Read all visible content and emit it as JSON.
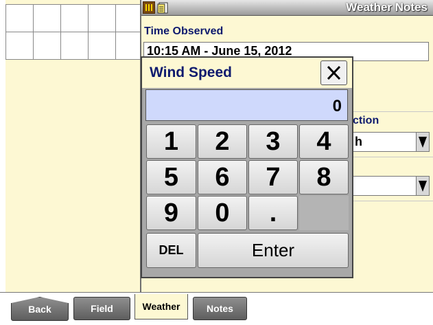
{
  "header": {
    "title": "Weather Notes",
    "icons": [
      "field-map-icon",
      "notepad-icon"
    ]
  },
  "form": {
    "time_label": "Time Observed",
    "time_value": "10:15 AM - June 15, 2012",
    "direction_label_partial": "ction",
    "direction_value_partial": "h"
  },
  "keypad_dialog": {
    "title": "Wind Speed",
    "display_value": "0",
    "keys": [
      "1",
      "2",
      "3",
      "4",
      "5",
      "6",
      "7",
      "8",
      "9",
      "0",
      "."
    ],
    "del_label": "DEL",
    "enter_label": "Enter"
  },
  "tabs": [
    {
      "label": "Back",
      "state": "normal"
    },
    {
      "label": "Field",
      "state": "normal"
    },
    {
      "label": "Weather",
      "state": "active"
    },
    {
      "label": "Notes",
      "state": "normal"
    }
  ],
  "colors": {
    "panel": "#fdf8d3",
    "label_text": "#0e1a6e",
    "display_bg": "#cfd9fc",
    "keypad_bg": "#a8a8a8"
  }
}
